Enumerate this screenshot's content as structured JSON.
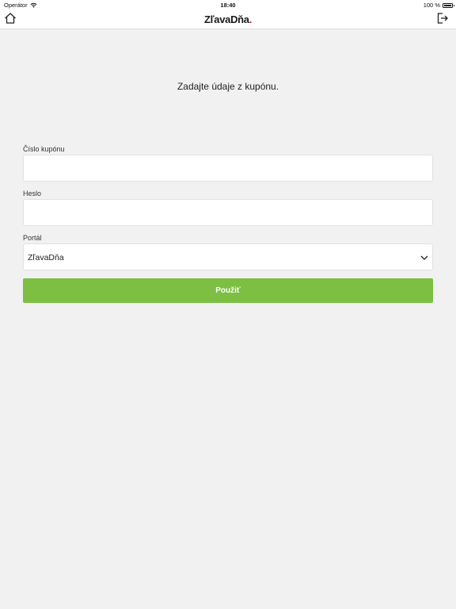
{
  "status_bar": {
    "carrier": "Operátor",
    "time": "18:40",
    "battery": "100 %",
    "icons": [
      "wifi-icon",
      "battery-icon"
    ]
  },
  "nav": {
    "logo_text": "ZľavaDňa",
    "logo_dot": ".",
    "logo_dot_color": "#d0141b",
    "icons": [
      "home-icon",
      "logout-icon"
    ]
  },
  "form": {
    "heading": "Zadajte údaje z kupónu.",
    "coupon_label": "Číslo kupónu",
    "coupon_value": "",
    "password_label": "Heslo",
    "password_value": "",
    "portal_label": "Portál",
    "portal_value": "ZľavaDňa",
    "submit_label": "Použiť"
  },
  "colors": {
    "accent": "#7cbf43",
    "background": "#f1f1f1"
  }
}
